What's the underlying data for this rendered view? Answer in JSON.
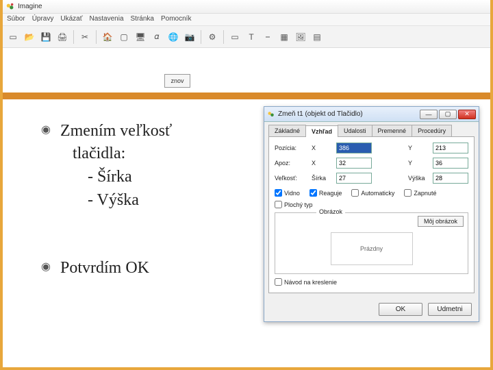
{
  "app": {
    "title": "Imagine",
    "menus": [
      "Súbor",
      "Úpravy",
      "Ukázať",
      "Nastavenia",
      "Stránka",
      "Pomocník"
    ],
    "znov_label": "znov"
  },
  "orange": {},
  "slide": {
    "bullet1_line1": "Zmením veľkosť",
    "bullet1_line2": "tlačidla:",
    "bullet1_sub1": "- Šírka",
    "bullet1_sub2": "- Výška",
    "bullet2": "Potvrdím OK"
  },
  "dialog": {
    "title": "Zmeň t1 (objekt od Tlačidlo)",
    "tabs": [
      "Základné",
      "Vzhľad",
      "Udalosti",
      "Premenné",
      "Procedúry"
    ],
    "active_tab_index": 1,
    "pos_label": "Pozícia:",
    "apos_label": "Apoz:",
    "size_label": "Veľkosť:",
    "x_label": "X",
    "y_label": "Y",
    "width_label": "Šírka",
    "height_label": "Výška",
    "pos_x": "386",
    "pos_y": "213",
    "apos_x": "32",
    "apos_y": "36",
    "width": "27",
    "height": "28",
    "checks": {
      "visible": "Vidno",
      "reacts": "Reaguje",
      "autoup": "Automaticky",
      "pinned": "Zapnuté",
      "visible_val": true,
      "reacts_val": true,
      "autoup_val": false,
      "pinned_val": false
    },
    "flat_label": "Plochý typ",
    "flat_val": false,
    "group_legend": "Obrázok",
    "my_image_btn": "Môj obrázok",
    "preview_text": "Prázdny",
    "hint_label": "Návod na kreslenie",
    "hint_val": false,
    "ok": "OK",
    "cancel": "Udmetni"
  }
}
